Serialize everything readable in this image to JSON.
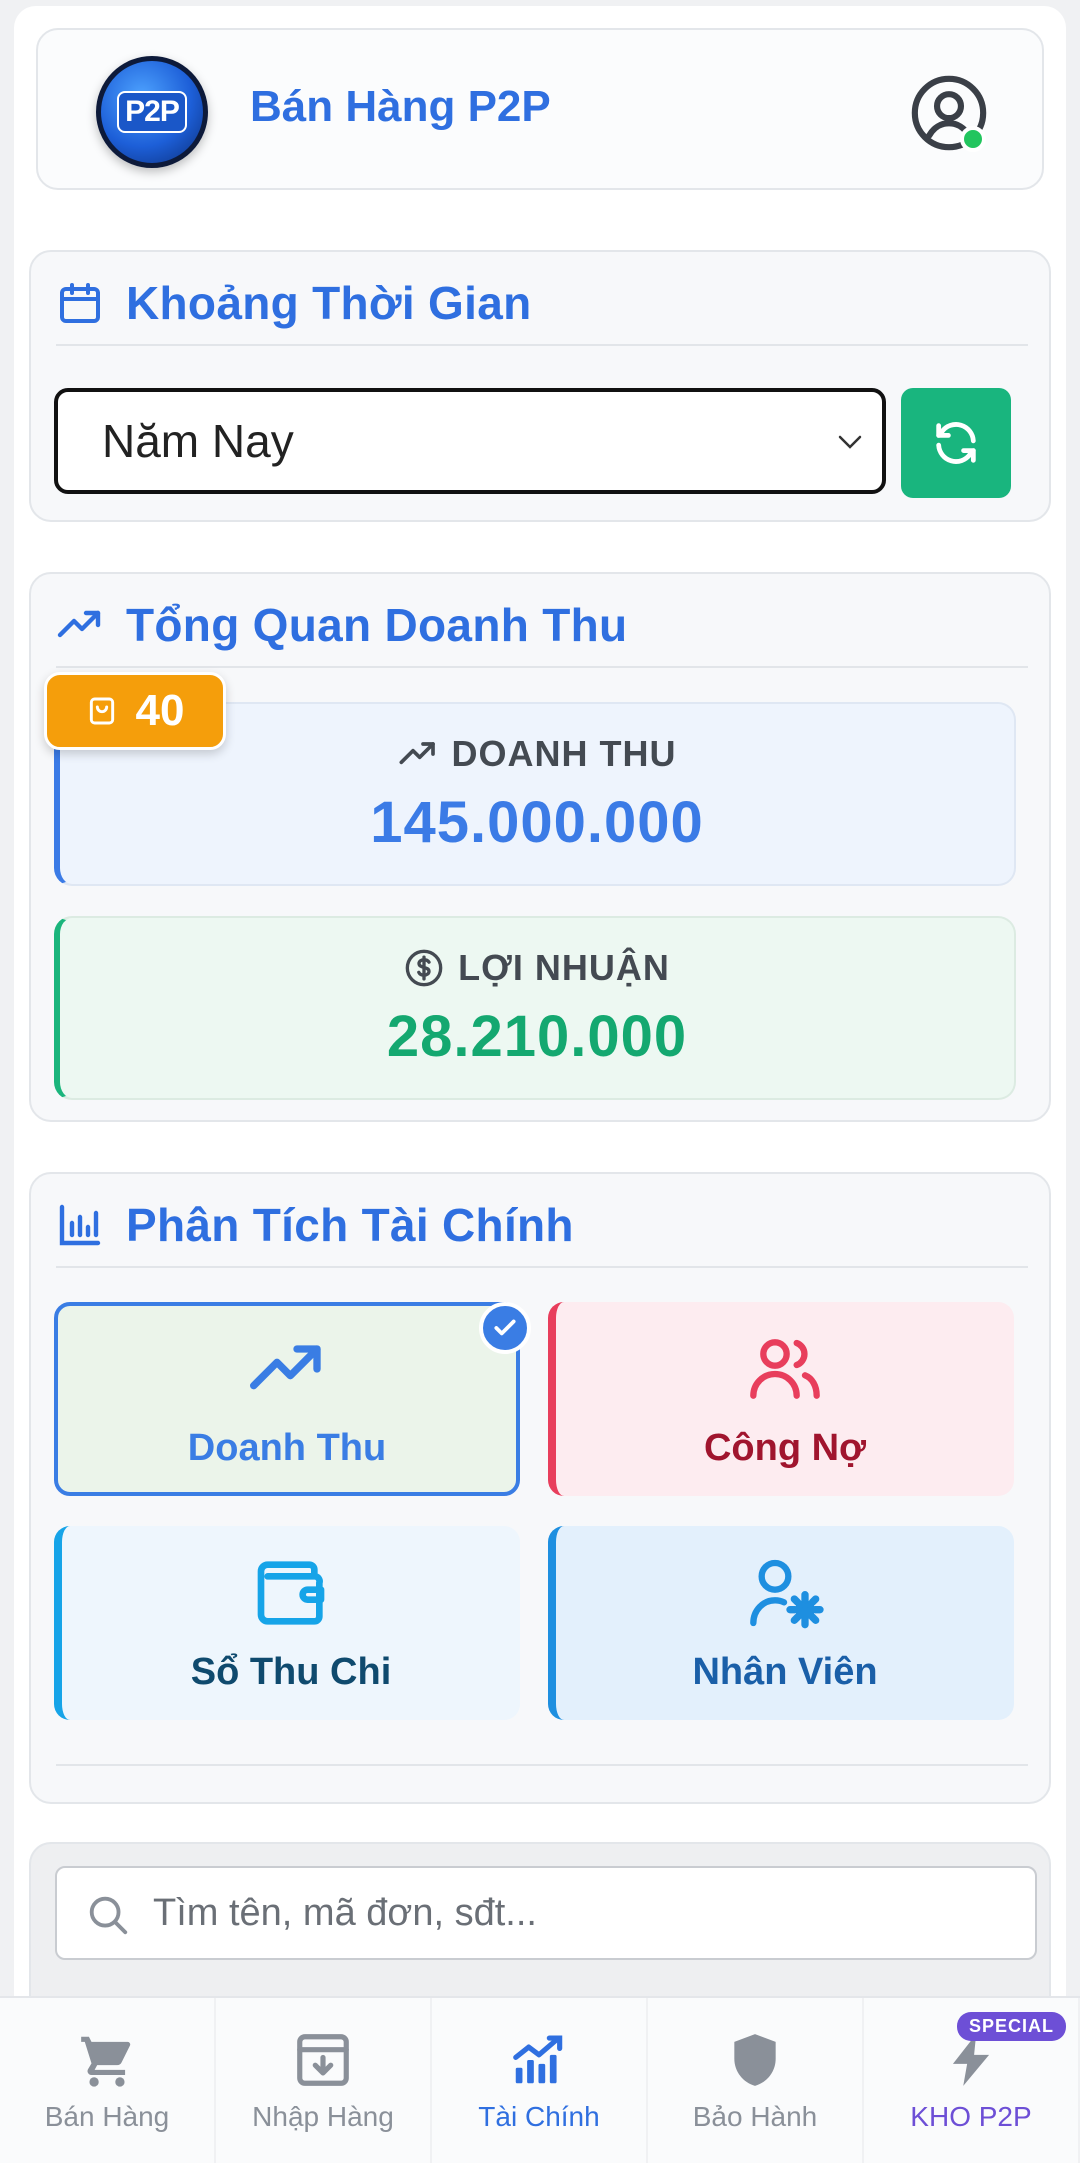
{
  "header": {
    "logo_text": "P2P",
    "brand": "Bán Hàng P2P"
  },
  "time_range": {
    "title": "Khoảng Thời Gian",
    "selected": "Năm Nay"
  },
  "revenue_overview": {
    "title": "Tổng Quan Doanh Thu",
    "order_count": "40",
    "revenue_label": "DOANH THU",
    "revenue_value": "145.000.000",
    "profit_label": "LỢI NHUẬN",
    "profit_value": "28.210.000"
  },
  "finance_analysis": {
    "title": "Phân Tích Tài Chính",
    "tiles": [
      {
        "label": "Doanh Thu",
        "icon": "trending-up-icon",
        "selected": true
      },
      {
        "label": "Công Nợ",
        "icon": "users-icon"
      },
      {
        "label": "Sổ Thu Chi",
        "icon": "wallet-icon"
      },
      {
        "label": "Nhân Viên",
        "icon": "user-gear-icon"
      }
    ]
  },
  "search": {
    "placeholder": "Tìm tên, mã đơn, sđt..."
  },
  "bottom_nav": {
    "items": [
      {
        "label": "Bán Hàng",
        "icon": "cart-icon"
      },
      {
        "label": "Nhập Hàng",
        "icon": "inbox-download-icon"
      },
      {
        "label": "Tài Chính",
        "icon": "chart-icon",
        "active": true
      },
      {
        "label": "Bảo Hành",
        "icon": "shield-icon"
      },
      {
        "label": "KHO P2P",
        "icon": "lightning-icon",
        "tag": "SPECIAL"
      }
    ]
  },
  "colors": {
    "primary": "#2f6fe0",
    "success": "#19b57e",
    "warning": "#f59e0b",
    "danger": "#e83e5c",
    "special": "#6d4fd6"
  }
}
